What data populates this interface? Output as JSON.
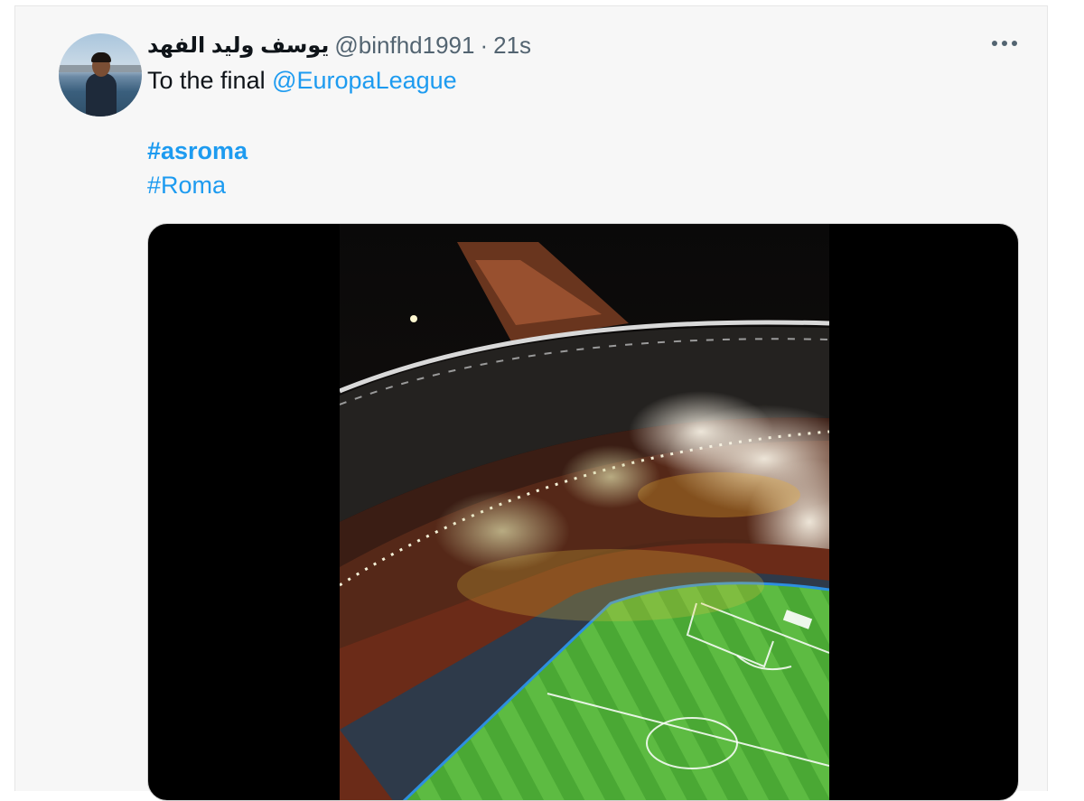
{
  "tweet": {
    "display_name": "يوسف وليد الفهد",
    "handle": "@binfhd1991",
    "separator": "·",
    "timestamp": "21s",
    "more_icon": "more-horizontal-icon",
    "text_prefix": "To the final ",
    "mention": "@EuropaLeague",
    "hashtag1": "#asroma",
    "hashtag2": "#Roma"
  },
  "colors": {
    "link": "#1d9bf0",
    "card_background": "#f7f7f7",
    "media_background": "#000000"
  }
}
